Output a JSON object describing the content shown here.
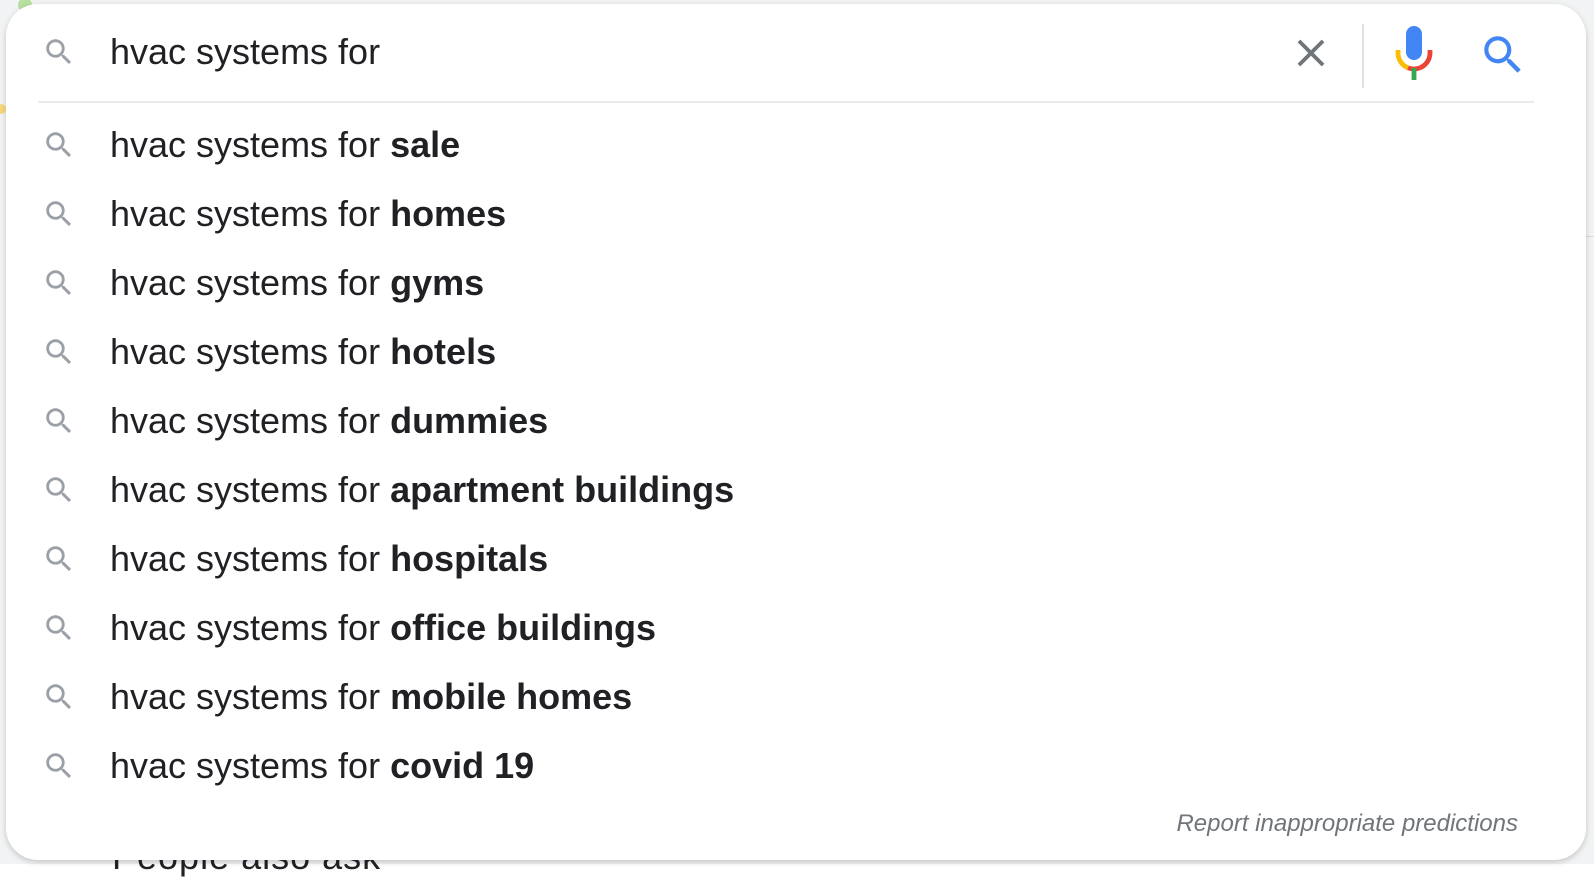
{
  "search": {
    "query": "hvac systems for",
    "clear_icon": "close-icon",
    "voice_icon": "microphone-icon",
    "submit_icon": "search-icon"
  },
  "suggestions": [
    {
      "prefix": "hvac systems for ",
      "completion": "sale"
    },
    {
      "prefix": "hvac systems for ",
      "completion": "homes"
    },
    {
      "prefix": "hvac systems for ",
      "completion": "gyms"
    },
    {
      "prefix": "hvac systems for ",
      "completion": "hotels"
    },
    {
      "prefix": "hvac systems for ",
      "completion": "dummies"
    },
    {
      "prefix": "hvac systems for ",
      "completion": "apartment buildings"
    },
    {
      "prefix": "hvac systems for ",
      "completion": "hospitals"
    },
    {
      "prefix": "hvac systems for ",
      "completion": "office buildings"
    },
    {
      "prefix": "hvac systems for ",
      "completion": "mobile homes"
    },
    {
      "prefix": "hvac systems for ",
      "completion": "covid 19"
    }
  ],
  "footer": {
    "report_label": "Report inappropriate predictions"
  },
  "background": {
    "partial_heading": "People also ask"
  },
  "colors": {
    "text": "#202124",
    "icon_gray": "#9aa0a6",
    "search_blue": "#4285f4",
    "mic_red": "#ea4335",
    "mic_yellow": "#fbbc04",
    "mic_green": "#34a853"
  }
}
